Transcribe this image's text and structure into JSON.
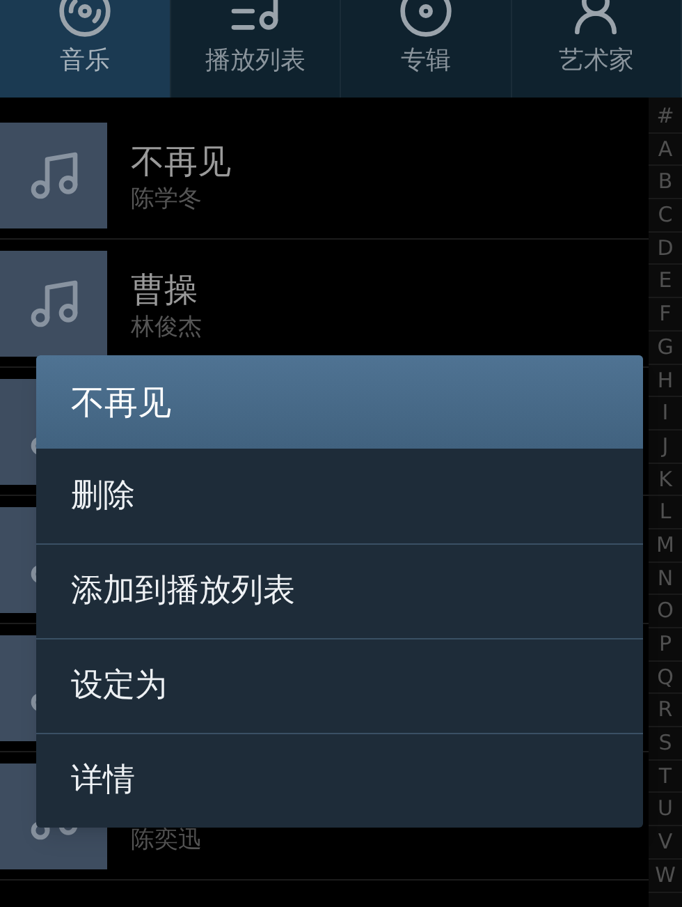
{
  "tabs": [
    {
      "label": "音乐",
      "kind": "disc",
      "selected": true
    },
    {
      "label": "播放列表",
      "kind": "playlist",
      "selected": false
    },
    {
      "label": "专辑",
      "kind": "album",
      "selected": false
    },
    {
      "label": "艺术家",
      "kind": "artist",
      "selected": false
    }
  ],
  "songs": [
    {
      "kind": "song",
      "title": "不再见",
      "artist": "陈学冬"
    },
    {
      "kind": "song",
      "title": "曹操",
      "artist": "林俊杰"
    },
    {
      "kind": "song"
    },
    {
      "kind": "song"
    },
    {
      "kind": "song"
    },
    {
      "kind": "song",
      "artist": "陈奕迅"
    }
  ],
  "index": [
    "#",
    "A",
    "B",
    "C",
    "D",
    "E",
    "F",
    "G",
    "H",
    "I",
    "J",
    "K",
    "L",
    "M",
    "N",
    "O",
    "P",
    "Q",
    "R",
    "S",
    "T",
    "U",
    "V",
    "W"
  ],
  "context_menu": {
    "title": "不再见",
    "items": [
      "删除",
      "添加到播放列表",
      "设定为",
      "详情"
    ]
  }
}
